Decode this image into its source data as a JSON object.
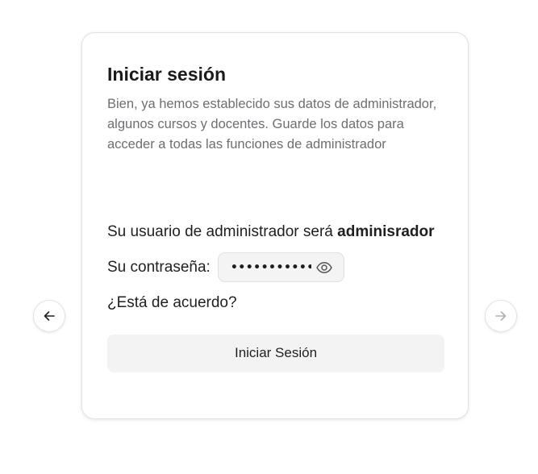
{
  "card": {
    "title": "Iniciar sesión",
    "description": "Bien, ya hemos establecido sus datos de administrador, algunos cursos y docentes. Guarde los datos para acceder a todas las funciones de administrador",
    "user_prefix": "Su usuario de administrador será ",
    "username": "adminisrador",
    "password_label": "Su contraseña:",
    "password_masked": "•••••••••••••",
    "question": "¿Está de acuerdo?",
    "login_button_label": "Iniciar Sesión"
  },
  "nav": {
    "prev_icon": "arrow-left-icon",
    "next_icon": "arrow-right-icon",
    "prev_enabled": true,
    "next_enabled": false
  },
  "icons": {
    "password_toggle": "eye-icon"
  },
  "colors": {
    "description_text": "#6e6e73",
    "button_bg": "#f3f3f3",
    "password_field_bg": "#f4f4f4",
    "disabled_arrow": "#b0b0b0"
  }
}
